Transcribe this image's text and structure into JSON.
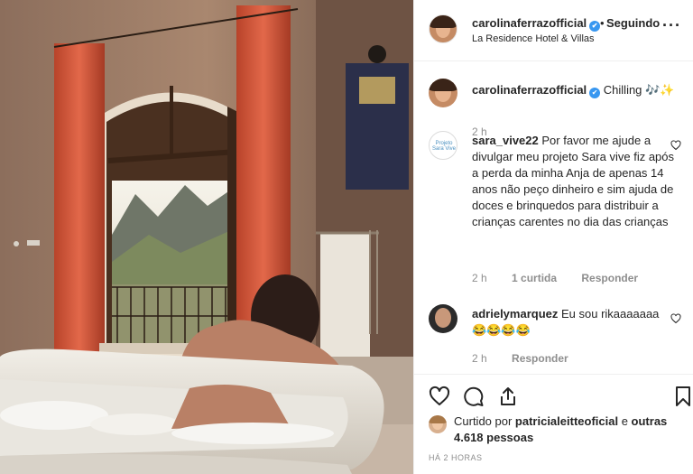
{
  "post": {
    "username": "carolinaferrazofficial",
    "verified_icon": "verified-badge-icon",
    "follow_separator": "•",
    "follow_status": "Seguindo",
    "location": "La Residence Hotel & Villas",
    "more_icon": "more-options-icon",
    "more_label": "···"
  },
  "comments": [
    {
      "username": "carolinaferrazofficial",
      "text": "Chilling 🎶✨",
      "time": "2 h"
    },
    {
      "username": "sara_vive22",
      "avatar_text": "Projeto Sara Vive",
      "text": "Por favor me ajude a divulgar meu projeto Sara vive fiz após a perda da minha Anja de apenas 14 anos não peço dinheiro e sim ajuda de doces e brinquedos para distribuir a crianças carentes no dia das crianças",
      "time": "2 h",
      "likes": "1 curtida",
      "reply": "Responder"
    },
    {
      "username": "adrielymarquez",
      "text": "Eu sou rikaaaaaaa 😂😂😂😂",
      "time": "2 h",
      "reply": "Responder"
    }
  ],
  "actions": {
    "like_icon": "heart-icon",
    "comment_icon": "comment-icon",
    "share_icon": "share-icon",
    "save_icon": "bookmark-icon"
  },
  "likes": {
    "prefix": "Curtido por ",
    "user": "patricialeitteoficial",
    "middle": " e ",
    "others": "outras 4.618 pessoas"
  },
  "timestamp": "HÁ 2 HORAS",
  "colors": {
    "verified": "#3897f0",
    "text": "#262626",
    "secondary": "#8e8e8e",
    "border": "#efefef"
  }
}
